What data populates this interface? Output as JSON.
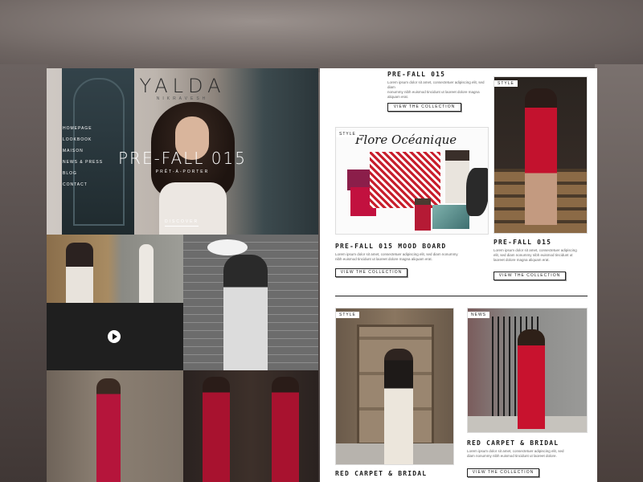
{
  "left": {
    "logo": "YALDA",
    "logo_sub": "NIKRAVESH",
    "nav": [
      "HOMEPAGE",
      "LOOKBOOK",
      "MAISON",
      "NEWS & PRESS",
      "BLOG",
      "CONTACT"
    ],
    "hero_title": "PRE-FALL 015",
    "hero_subtitle": "PRÊT-À-PORTER",
    "hero_button": "DISCOVER"
  },
  "right": {
    "section1": {
      "title": "PRE-FALL 015",
      "desc_lines": [
        "Lorem ipsum dolor sit amet, consectetuer adipiscing elit, sed diam",
        "nonummy nibh euismod tincidunt ut laoreet dolore magna aliquam erat."
      ],
      "button": "VIEW THE COLLECTION"
    },
    "mood": {
      "tag": "STYLE",
      "script": "Flore Océanique",
      "title": "PRE-FALL 015 MOOD BOARD",
      "desc_lines": [
        "Lorem ipsum dolor sit amet, consectetuer adipiscing elit, sed diam nonummy",
        "nibh euismod tincidunt ut laoreet dolore magna aliquam erat."
      ],
      "button": "VIEW THE COLLECTION"
    },
    "stair": {
      "tag": "STYLE",
      "title": "PRE-FALL 015",
      "desc_lines": [
        "Lorem ipsum dolor sit amet, consectetuer adipiscing",
        "elit, sed diam nonummy nibh euismod tincidunt ut",
        "laoreet dolore magna aliquam erat."
      ],
      "button": "VIEW THE COLLECTION"
    },
    "door": {
      "tag": "STYLE",
      "title": "RED CARPET & BRIDAL"
    },
    "gate": {
      "tag": "NEWS",
      "title": "RED CARPET & BRIDAL",
      "desc_lines": [
        "Lorem ipsum dolor sit amet, consectetuer adipiscing elit, sed",
        "diam nonummy nibh euismod tincidunt ut laoreet dolore."
      ],
      "button": "VIEW THE COLLECTION"
    }
  },
  "colors": {
    "accent_red": "#c3122e",
    "text_dark": "#1a1a1a",
    "paper": "#ffffff"
  },
  "icons": {
    "play": "play-icon"
  }
}
